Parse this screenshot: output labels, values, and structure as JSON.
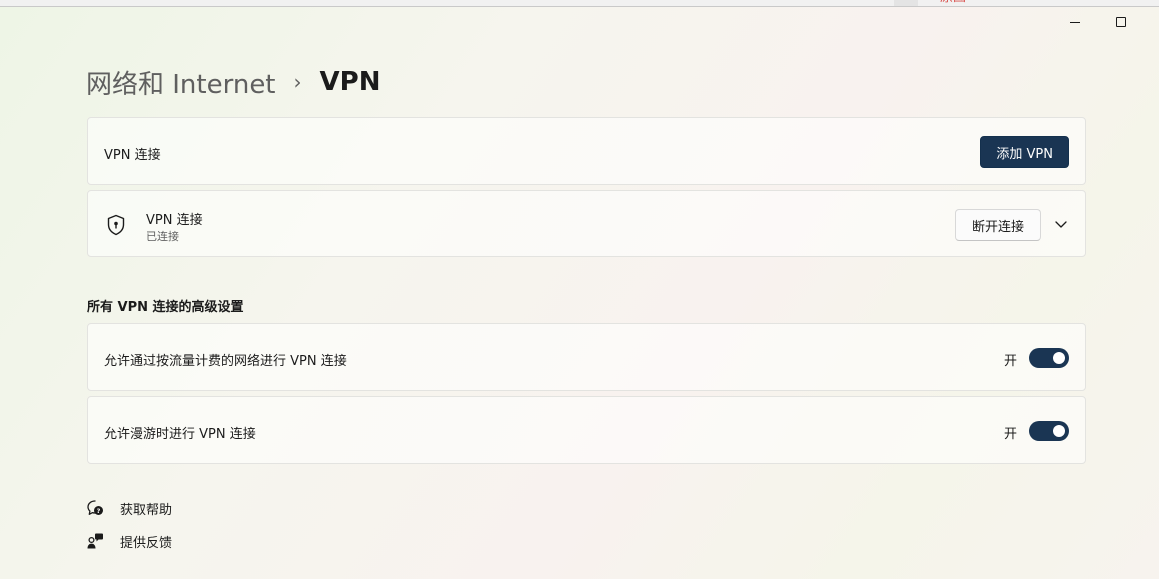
{
  "top_strip": {
    "clipped_text": "原图"
  },
  "window": {
    "minimize_icon": "minimize-icon",
    "maximize_icon": "maximize-icon"
  },
  "breadcrumb": {
    "parent": "网络和 Internet",
    "separator": "›",
    "current": "VPN"
  },
  "vpn_section": {
    "label": "VPN 连接",
    "add_button": "添加 VPN"
  },
  "vpn_connection": {
    "icon": "shield-icon",
    "name": "VPN 连接",
    "status": "已连接",
    "disconnect_button": "断开连接",
    "expand_icon": "chevron-down-icon"
  },
  "advanced": {
    "title": "所有 VPN 连接的高级设置",
    "settings": [
      {
        "label": "允许通过按流量计费的网络进行 VPN 连接",
        "state_label": "开",
        "on": true
      },
      {
        "label": "允许漫游时进行 VPN 连接",
        "state_label": "开",
        "on": true
      }
    ]
  },
  "links": {
    "help": {
      "label": "获取帮助",
      "icon": "help-chat-icon"
    },
    "feedback": {
      "label": "提供反馈",
      "icon": "feedback-person-icon"
    }
  },
  "colors": {
    "accent": "#1a3553",
    "text": "#1b1b1b",
    "secondary_text": "#5f5f5f"
  }
}
